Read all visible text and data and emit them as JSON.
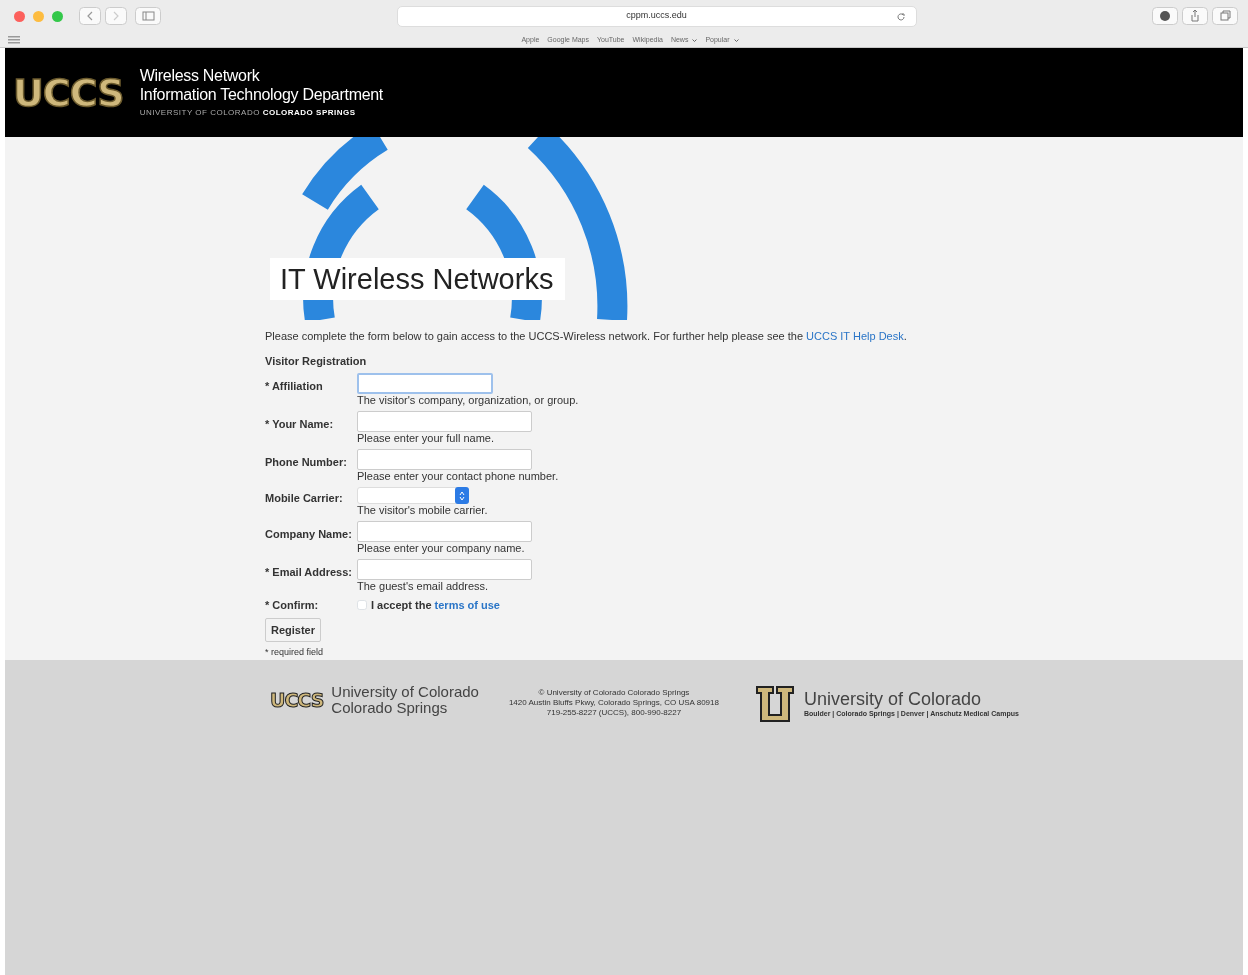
{
  "browser": {
    "url": "cppm.uccs.edu",
    "bookmarks": [
      {
        "label": "Apple",
        "menu": false
      },
      {
        "label": "Google Maps",
        "menu": false
      },
      {
        "label": "YouTube",
        "menu": false
      },
      {
        "label": "Wikipedia",
        "menu": false
      },
      {
        "label": "News",
        "menu": true
      },
      {
        "label": "Popular",
        "menu": true
      }
    ]
  },
  "header": {
    "logo": "UCCS",
    "title": "Wireless Network",
    "subtitle": "Information Technology Department",
    "university": "UNIVERSITY OF COLORADO",
    "campus": "COLORADO SPRINGS"
  },
  "hero": {
    "title": "IT Wireless Networks"
  },
  "intro": {
    "text": "Please complete the form below to gain access to the UCCS-Wireless network. For further help please see the",
    "link": "UCCS IT Help Desk",
    "end": "."
  },
  "form": {
    "heading": "Visitor Registration",
    "fields": [
      {
        "kind": "text",
        "label": "* Affiliation",
        "hint": "The visitor's company, organization, or group.",
        "focused": true
      },
      {
        "kind": "text",
        "label": "* Your Name:",
        "hint": "Please enter your full name.",
        "focused": false
      },
      {
        "kind": "text",
        "label": "Phone Number:",
        "hint": "Please enter your contact phone number.",
        "focused": false
      },
      {
        "kind": "select",
        "label": "Mobile Carrier:",
        "hint": "The visitor's mobile carrier.",
        "focused": false
      },
      {
        "kind": "text",
        "label": "Company Name:",
        "hint": "Please enter your company name.",
        "focused": false
      },
      {
        "kind": "text",
        "label": "* Email Address:",
        "hint": "The guest's email address.",
        "focused": false
      }
    ],
    "confirm": {
      "label": "* Confirm:",
      "text": "I accept the",
      "link": "terms of use",
      "checked": false
    },
    "button": "Register",
    "note": "* required field"
  },
  "footer": {
    "logo": "UCCS",
    "name_line1": "University of Colorado",
    "name_line2": "Colorado Springs",
    "address": [
      "© University of Colorado Colorado Springs",
      "1420 Austin Bluffs Pkwy, Colorado Springs, CO USA 80918",
      "719-255-8227 (UCCS), 800-990-8227"
    ],
    "cu_name": "University of Colorado",
    "campuses": "Boulder | Colorado Springs | Denver | Anschutz Medical Campus"
  }
}
